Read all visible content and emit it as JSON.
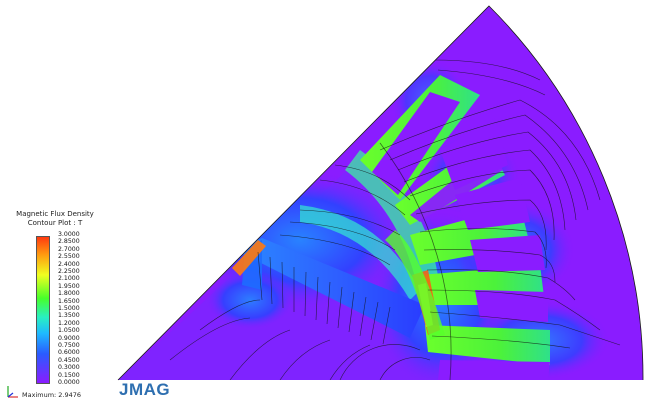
{
  "legend": {
    "title_line1": "Magnetic Flux Density",
    "title_line2": "Contour Plot : T",
    "ticks": [
      "3.0000",
      "2.8500",
      "2.7000",
      "2.5500",
      "2.4000",
      "2.2500",
      "2.1000",
      "1.9500",
      "1.8000",
      "1.6500",
      "1.5000",
      "1.3500",
      "1.2000",
      "1.0500",
      "0.9000",
      "0.7500",
      "0.6000",
      "0.4500",
      "0.3000",
      "0.1500",
      "0.0000"
    ],
    "maximum_label": "Maximum: 2.9476"
  },
  "brand": {
    "name": "JMAG"
  },
  "colors": {
    "low": "#8a1cff",
    "mid_low": "#2a5cff",
    "mid": "#29f0c2",
    "mid_high": "#47ff2a",
    "high": "#ff3a10"
  },
  "icons": {
    "axis_triad": "xyz-axes-icon"
  }
}
